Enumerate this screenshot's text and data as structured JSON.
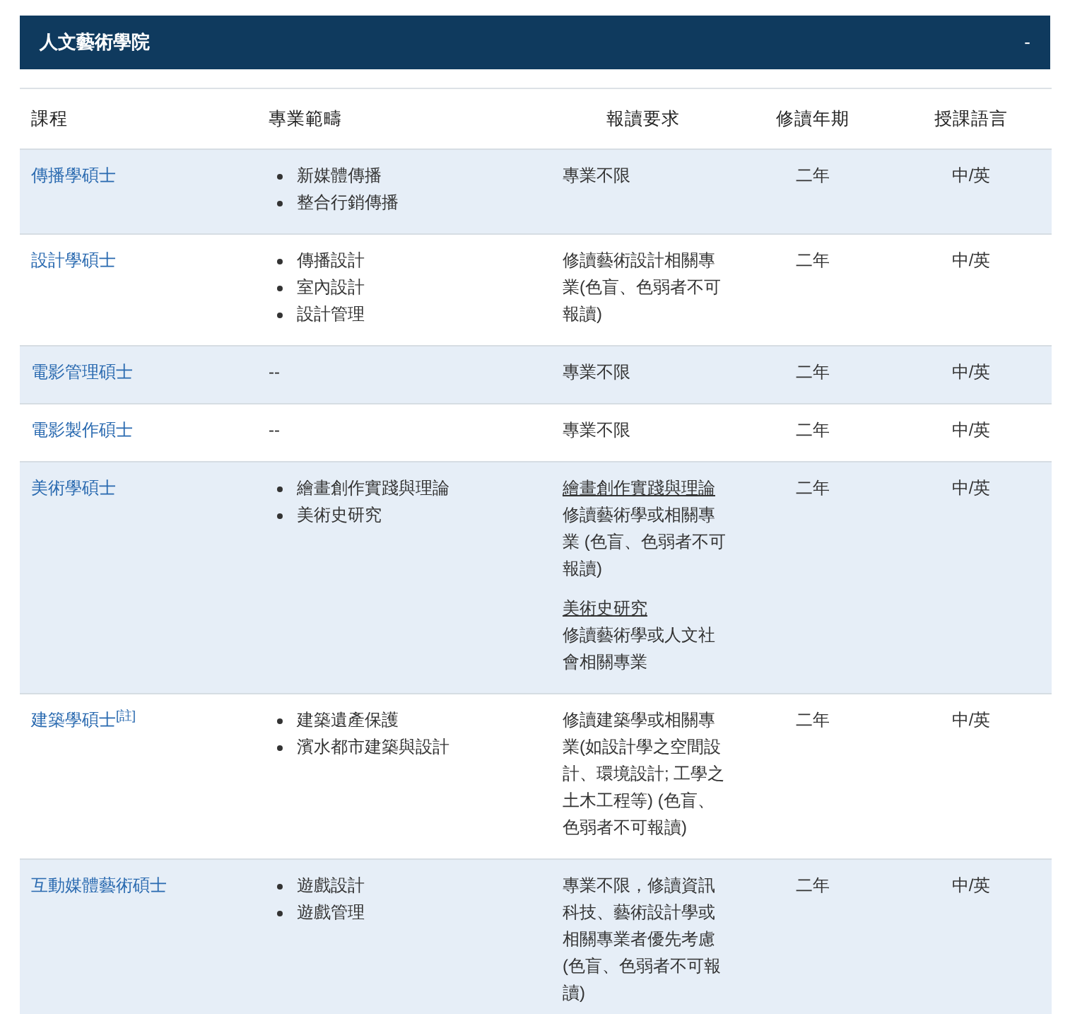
{
  "panel": {
    "title": "人文藝術學院",
    "toggle": "-",
    "expanded": true
  },
  "table": {
    "columns": [
      "課程",
      "專業範疇",
      "報讀要求",
      "修讀年期",
      "授課語言"
    ],
    "rows": [
      {
        "course": "傳播學碩士",
        "scopes": [
          "新媒體傳播",
          "整合行銷傳播"
        ],
        "requirements": [
          {
            "text": "專業不限"
          }
        ],
        "years": "二年",
        "language": "中/英"
      },
      {
        "course": "設計學碩士",
        "scopes": [
          "傳播設計",
          "室內設計",
          "設計管理"
        ],
        "requirements": [
          {
            "text": "修讀藝術設計相關專業(色盲、色弱者不可報讀)"
          }
        ],
        "years": "二年",
        "language": "中/英"
      },
      {
        "course": "電影管理碩士",
        "scope_text": "--",
        "requirements": [
          {
            "text": "專業不限"
          }
        ],
        "years": "二年",
        "language": "中/英"
      },
      {
        "course": "電影製作碩士",
        "scope_text": "--",
        "requirements": [
          {
            "text": "專業不限"
          }
        ],
        "years": "二年",
        "language": "中/英"
      },
      {
        "course": "美術學碩士",
        "scopes": [
          "繪畫創作實踐與理論",
          "美術史研究"
        ],
        "requirements": [
          {
            "heading": "繪畫創作實踐與理論",
            "text": "修讀藝術學或相關專業 (色盲、色弱者不可報讀)"
          },
          {
            "heading": "美術史研究",
            "text": "修讀藝術學或人文社會相關專業"
          }
        ],
        "years": "二年",
        "language": "中/英"
      },
      {
        "course": "建築學碩士$^{[註]}$",
        "scopes": [
          "建築遺產保護",
          "濱水都市建築與設計"
        ],
        "requirements": [
          {
            "text": "修讀建築學或相關專業(如設計學之空間設計、環境設計; 工學之土木工程等) (色盲、色弱者不可報讀)"
          }
        ],
        "years": "二年",
        "language": "中/英"
      },
      {
        "course": "互動媒體藝術碩士",
        "scopes": [
          "遊戲設計",
          "遊戲管理"
        ],
        "requirements": [
          {
            "text": "專業不限，修讀資訊科技、藝術設計學或相關專業者優先考慮(色盲、色弱者不可報讀)"
          }
        ],
        "years": "二年",
        "language": "中/英"
      }
    ]
  }
}
